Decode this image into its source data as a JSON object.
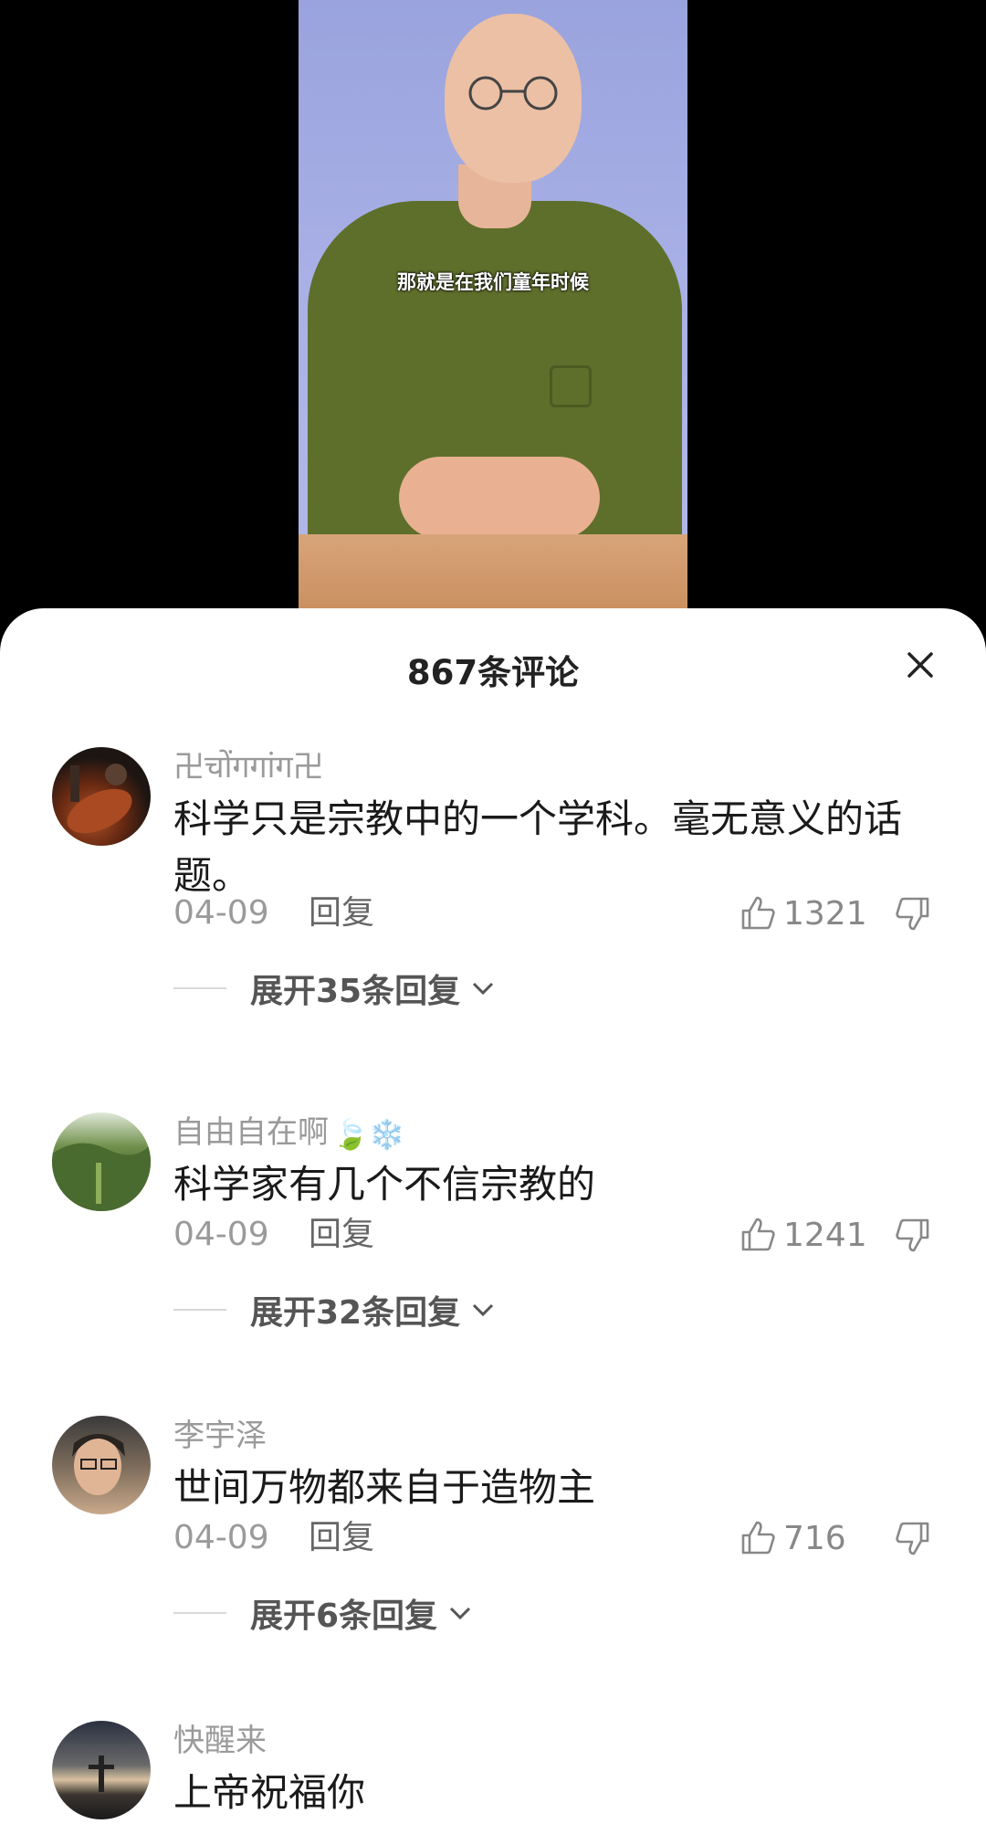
{
  "video": {
    "subtitle": "那就是在我们童年时候"
  },
  "sheet": {
    "title": "867条评论"
  },
  "comments": [
    {
      "username": "卍चोंगगांग卍",
      "content": "科学只是宗教中的一个学科。毫无意义的话题。",
      "date": "04-09",
      "reply_label": "回复",
      "likes": "1321",
      "expand_label": "展开35条回复"
    },
    {
      "username": "自由自在啊",
      "emoji": "🍃❄️",
      "content": "科学家有几个不信宗教的",
      "date": "04-09",
      "reply_label": "回复",
      "likes": "1241",
      "expand_label": "展开32条回复"
    },
    {
      "username": "李宇泽",
      "content": "世间万物都来自于造物主",
      "date": "04-09",
      "reply_label": "回复",
      "likes": "716",
      "expand_label": "展开6条回复"
    },
    {
      "username": "快醒来",
      "content": "上帝祝福你"
    }
  ]
}
